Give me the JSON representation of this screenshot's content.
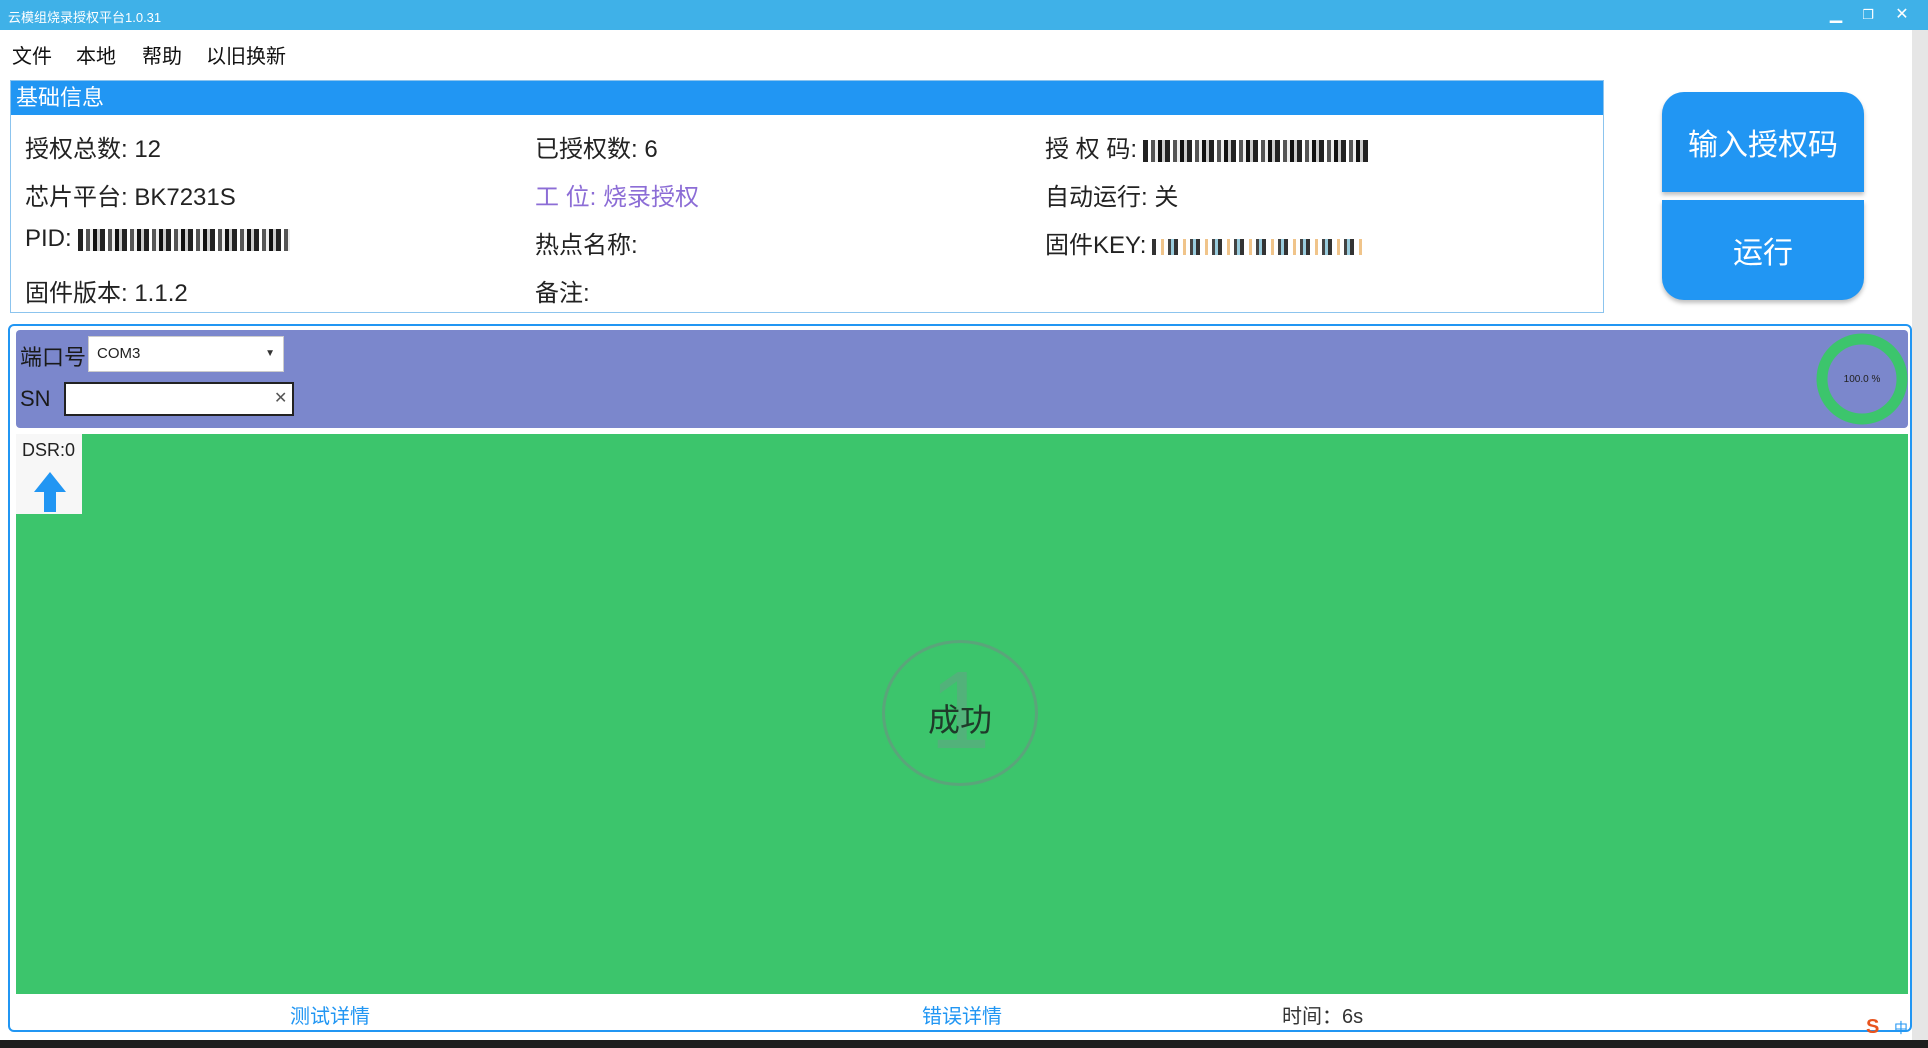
{
  "window": {
    "title": "云模组烧录授权平台1.0.31",
    "minimize": "▁",
    "restore": "❐",
    "close": "✕"
  },
  "menu": [
    "文件",
    "本地",
    "帮助",
    "以旧换新"
  ],
  "info": {
    "header": "基础信息",
    "total_auth": "授权总数: 12",
    "authorized": "已授权数: 6",
    "auth_code_label": "授 权 码:",
    "chip_platform": "芯片平台: BK7231S",
    "station": "工 位: 烧录授权",
    "auto_run": "自动运行: 关",
    "pid_label": "PID:",
    "hotspot": "热点名称:",
    "firmware_key_label": "固件KEY:",
    "firmware_version": "固件版本: 1.1.2",
    "remark": "备注:"
  },
  "buttons": {
    "input_auth_code": "输入授权码",
    "run": "运行"
  },
  "port": {
    "port_label": "端口号",
    "port_value": "COM3",
    "sn_label": "SN",
    "sn_value": ""
  },
  "progress": {
    "text": "100.0 %",
    "value": 100.0,
    "ring_color": "#3cc56c",
    "center_color": "#7b87cc"
  },
  "result": {
    "dsr": "DSR:0",
    "count": "1",
    "status": "成功",
    "bg_color": "#3cc56c"
  },
  "footer": {
    "test_details": "测试详情",
    "error_details": "错误详情",
    "time": "时间：6s"
  },
  "tray": {
    "ime_icon": "S",
    "ime_label": "中"
  },
  "colors": {
    "accent": "#2196f3",
    "titlebar": "#3fb1e8",
    "port_panel": "#7b87cc"
  }
}
